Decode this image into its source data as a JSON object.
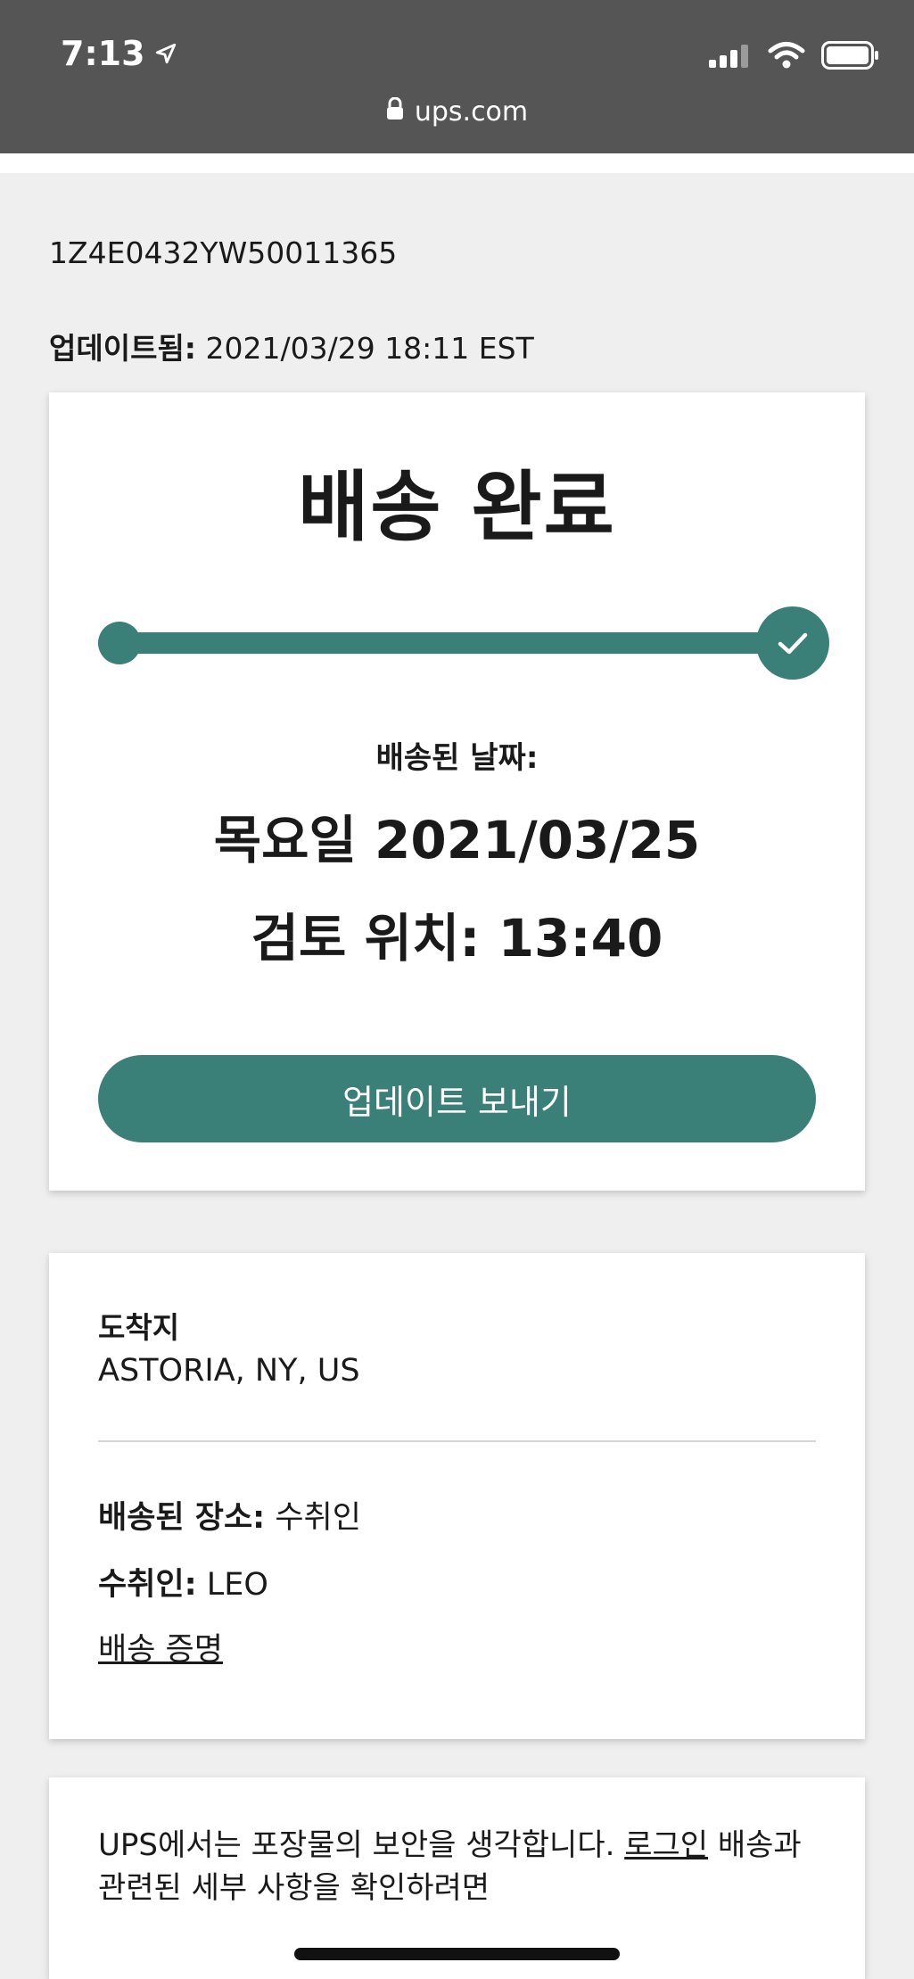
{
  "status_bar": {
    "time": "7:13",
    "url": "ups.com",
    "icons": [
      "location-arrow-icon",
      "signal-icon",
      "wifi-icon",
      "battery-icon",
      "lock-icon"
    ]
  },
  "tracking_number": "1Z4E0432YW50011365",
  "updated": {
    "label": "업데이트됨:",
    "value": "2021/03/29 18:11 EST"
  },
  "delivery_card": {
    "status": "배송 완료",
    "delivered_label": "배송된 날짜:",
    "delivered_date": "목요일 2021/03/25",
    "review_time": "검토 위치: 13:40",
    "button_label": "업데이트 보내기",
    "progress": 1.0,
    "accent_color": "#3b7f79"
  },
  "details_card": {
    "destination_label": "도착지",
    "destination_value": "ASTORIA, NY, US",
    "location_label": "배송된 장소:",
    "location_value": "수취인",
    "recipient_label": "수취인:",
    "recipient_value": "LEO",
    "proof_link": "배송 증명"
  },
  "security_card": {
    "text_before": "UPS에서는 포장물의 보안을 생각합니다. ",
    "login_link": "로그인",
    "text_after": " 배송과 관련된 세부 사항을 확인하려면"
  }
}
